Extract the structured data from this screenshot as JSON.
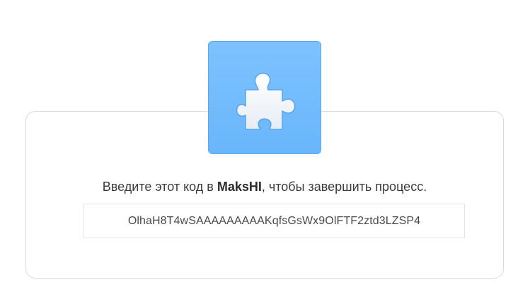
{
  "icon": {
    "name": "puzzle-piece-icon",
    "background": "#7cc2ff"
  },
  "message": {
    "before": "Введите этот код в ",
    "app_name": "MaksHI",
    "after": ", чтобы завершить процесс."
  },
  "code": {
    "value": "OlhaH8T4wSAAAAAAAAAKqfsGsWx9OlFTF2ztd3LZSP4"
  }
}
